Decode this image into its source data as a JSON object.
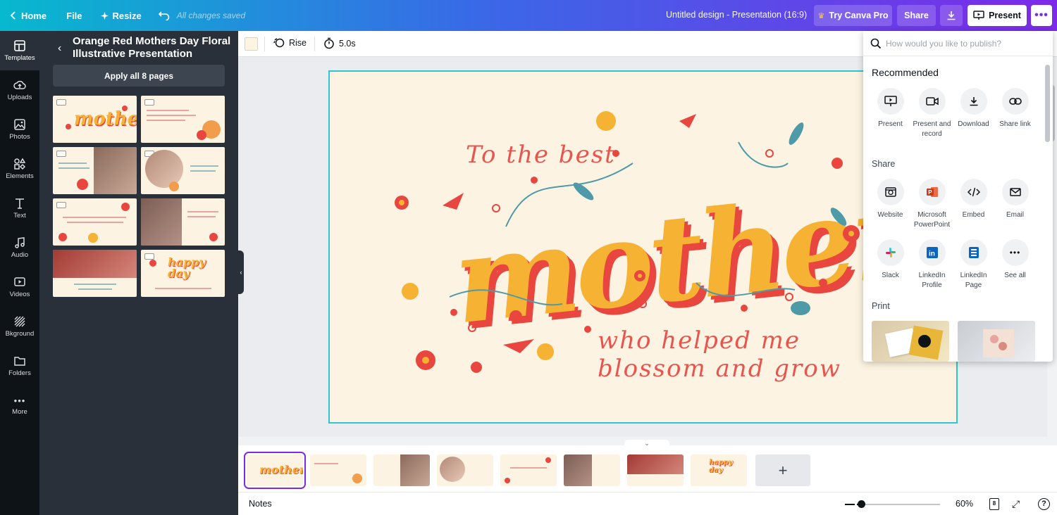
{
  "topbar": {
    "home": "Home",
    "file": "File",
    "resize": "Resize",
    "saved": "All changes saved",
    "title": "Untitled design - Presentation (16:9)",
    "try_pro": "Try Canva Pro",
    "share": "Share",
    "present": "Present"
  },
  "rail": [
    "Templates",
    "Uploads",
    "Photos",
    "Elements",
    "Text",
    "Audio",
    "Videos",
    "Bkground",
    "Folders",
    "More"
  ],
  "panel": {
    "title": "Orange Red Mothers Day Floral Illustrative Presentation",
    "apply": "Apply all 8 pages"
  },
  "toolbar": {
    "animation": "Rise",
    "duration": "5.0s"
  },
  "slide": {
    "line1": "To the best",
    "main": "mother",
    "line2": "who helped me",
    "line3": "blossom and grow"
  },
  "footer": {
    "notes": "Notes",
    "zoom": "60%",
    "pages": "8",
    "zoom_level": 0.05
  },
  "share_panel": {
    "search_placeholder": "How would you like to publish?",
    "recommended_heading": "Recommended",
    "recommended": [
      "Present",
      "Present and record",
      "Download",
      "Share link"
    ],
    "share_heading": "Share",
    "share_options": [
      "Website",
      "Microsoft PowerPoint",
      "Embed",
      "Email",
      "Slack",
      "LinkedIn Profile",
      "LinkedIn Page",
      "See all"
    ],
    "print_heading": "Print"
  },
  "colors": {
    "brand_gradient_start": "#07b9ce",
    "brand_gradient_end": "#7d2ae8",
    "slide_bg": "#fdf3e2",
    "accent_red": "#e8463e",
    "accent_yellow": "#f6b233",
    "selection": "#2ec5d3"
  }
}
